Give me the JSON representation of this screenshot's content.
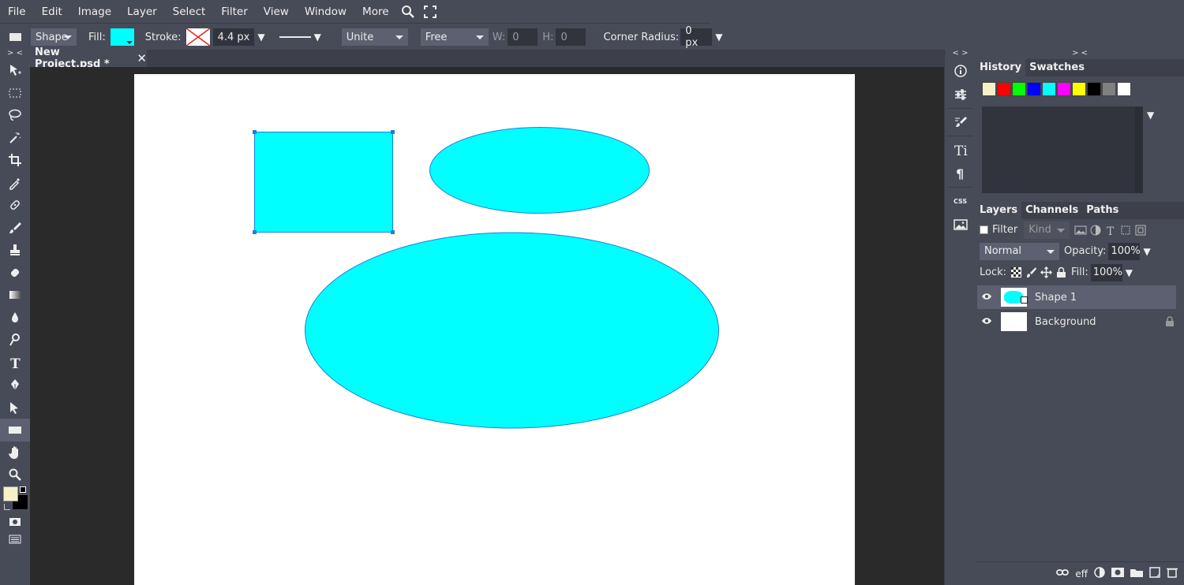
{
  "menu": [
    "File",
    "Edit",
    "Image",
    "Layer",
    "Select",
    "Filter",
    "View",
    "Window",
    "More"
  ],
  "options": {
    "shape_mode": "Shape",
    "fill_label": "Fill:",
    "fill_color": "#00ffff",
    "stroke_label": "Stroke:",
    "stroke_width": "4.4 px",
    "combine_mode": "Unite",
    "constraint": "Free",
    "w_label": "W:",
    "w_value": "0",
    "h_label": "H:",
    "h_value": "0",
    "corner_label": "Corner Radius:",
    "corner_value": "0 px"
  },
  "toolbar_top": "> <",
  "document": {
    "tab_title": "New Project.psd *",
    "close": "✕"
  },
  "canvas_shapes": {
    "color": "#00ffff",
    "stroke": "#1f7fd8"
  },
  "side_header": "< >",
  "right_header": "> <",
  "history_panel": {
    "tabs": [
      "History",
      "Swatches"
    ],
    "swatches": [
      "#f5f2c8",
      "#ff0000",
      "#00ff00",
      "#0000ff",
      "#00ffff",
      "#ff00ff",
      "#ffff00",
      "#000000",
      "#808080",
      "#ffffff"
    ]
  },
  "layers_panel": {
    "tabs": [
      "Layers",
      "Channels",
      "Paths"
    ],
    "filter_label": "Filter",
    "kind": "Kind",
    "blend_mode": "Normal",
    "opacity_label": "Opacity:",
    "opacity_value": "100%",
    "lock_label": "Lock:",
    "fill_label": "Fill:",
    "fill_value": "100%",
    "layers": [
      {
        "name": "Shape 1",
        "selected": true
      },
      {
        "name": "Background",
        "selected": false
      }
    ],
    "footer_eff": "eff"
  },
  "colors": {
    "foreground": "#f5f2c8",
    "background": "#000000"
  }
}
